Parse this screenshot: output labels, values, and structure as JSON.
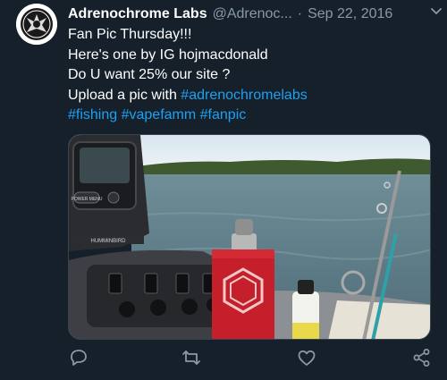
{
  "tweet": {
    "author_name": "Adrenochrome Labs",
    "handle": "@Adrenoc...",
    "separator": "·",
    "date": "Sep 22, 2016",
    "lines": [
      "Fan Pic Thursday!!!",
      "Here's one by IG hojmacdonald",
      "Do U want 25% our site ?"
    ],
    "upload_text": "Upload a pic with ",
    "hashtags": {
      "line1": "#adrenochromelabs",
      "fishing": "#fishing",
      "vapefamm": "#vapefamm",
      "fanpic": "#fanpic"
    },
    "media": {
      "gps_brand": "HUMMINBIRD",
      "gps_button_label": "POWER MENU"
    }
  },
  "icons": {
    "caret": "chevron-down-icon",
    "reply": "reply-icon",
    "retweet": "retweet-icon",
    "like": "like-icon",
    "share": "share-icon"
  },
  "colors": {
    "background": "#15202b",
    "link": "#1da1f2",
    "muted": "#8899a6",
    "text": "#ffffff"
  }
}
